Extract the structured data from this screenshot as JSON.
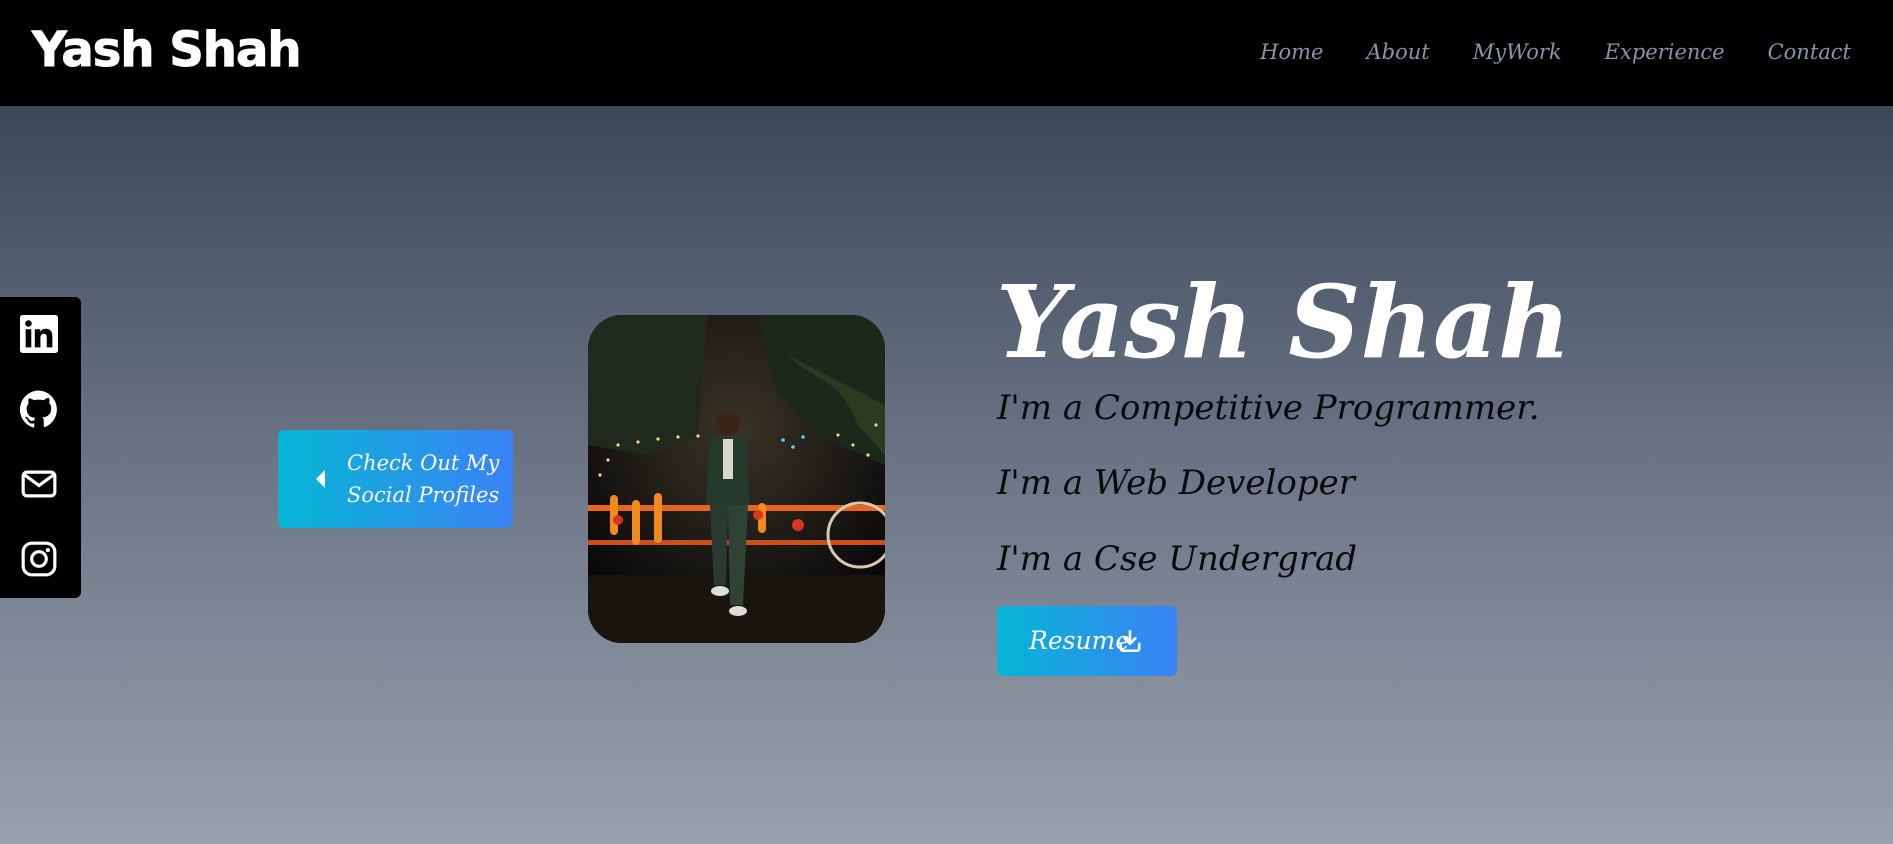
{
  "header": {
    "brand": "Yash Shah",
    "nav": [
      {
        "label": "Home"
      },
      {
        "label": "About"
      },
      {
        "label": "MyWork"
      },
      {
        "label": "Experience"
      },
      {
        "label": "Contact"
      }
    ]
  },
  "social": {
    "icons": [
      "linkedin-icon",
      "github-icon",
      "mail-icon",
      "instagram-icon"
    ],
    "toggle_label": "Check Out My Social Profiles",
    "toggle_icon": "caret-left-icon"
  },
  "hero": {
    "name": "Yash Shah",
    "roles": [
      "I'm a Competitive Programmer.",
      "I'm a Web Developer",
      "I'm a Cse Undergrad"
    ],
    "resume_label": "Resume",
    "resume_icon": "download-icon"
  },
  "colors": {
    "navbar": "#000000",
    "nav_link": "#8a93a6",
    "button_gradient_start": "#06b6d4",
    "button_gradient_end": "#3b82f6",
    "background_top": "#2f3a4c",
    "background_bottom": "#9aa1ad"
  }
}
